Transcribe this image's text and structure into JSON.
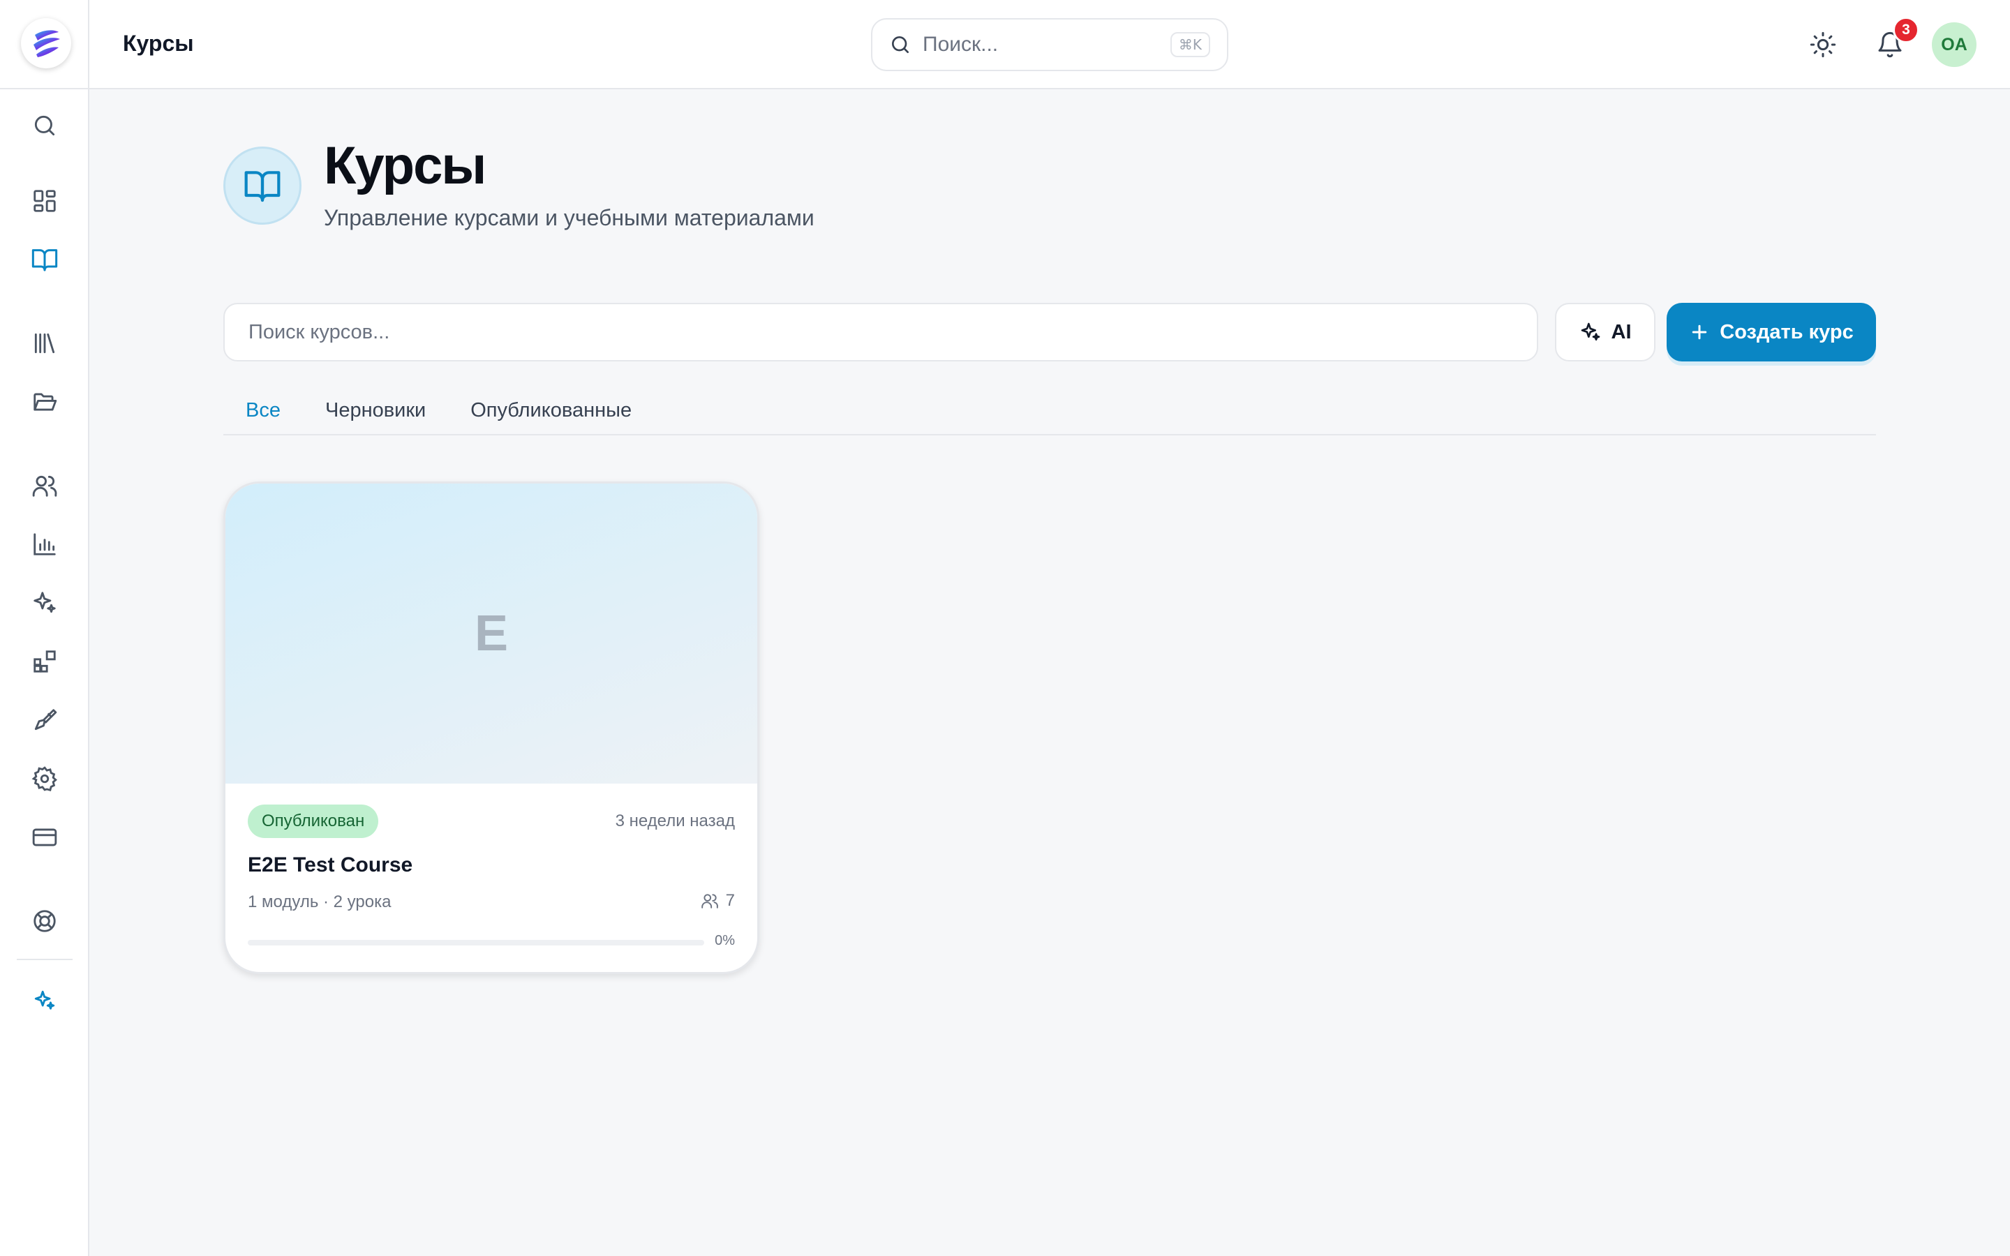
{
  "header": {
    "title": "Курсы",
    "search_placeholder": "Поиск...",
    "search_shortcut": "⌘K",
    "notifications_count": "3",
    "avatar_initials": "OA"
  },
  "sidebar": {
    "items": [
      {
        "name": "search",
        "icon": "search-icon"
      },
      {
        "name": "dashboard",
        "icon": "dashboard-icon"
      },
      {
        "name": "courses",
        "icon": "book-open-icon",
        "active": true
      },
      {
        "name": "library",
        "icon": "library-icon"
      },
      {
        "name": "files",
        "icon": "folder-open-icon"
      },
      {
        "name": "users",
        "icon": "users-icon"
      },
      {
        "name": "analytics",
        "icon": "bar-chart-icon"
      },
      {
        "name": "ai",
        "icon": "sparkles-icon"
      },
      {
        "name": "integrations",
        "icon": "blocks-icon"
      },
      {
        "name": "branding",
        "icon": "paintbrush-icon"
      },
      {
        "name": "settings",
        "icon": "gear-icon"
      },
      {
        "name": "billing",
        "icon": "credit-card-icon"
      },
      {
        "name": "support",
        "icon": "lifebuoy-icon"
      },
      {
        "name": "ai-assistant",
        "icon": "sparkles-icon"
      }
    ]
  },
  "page": {
    "title": "Курсы",
    "subtitle": "Управление курсами и учебными материалами",
    "search_placeholder": "Поиск курсов...",
    "ai_label": "AI",
    "create_label": "Создать курс"
  },
  "tabs": [
    {
      "label": "Все",
      "active": true
    },
    {
      "label": "Черновики",
      "active": false
    },
    {
      "label": "Опубликованные",
      "active": false
    }
  ],
  "courses": [
    {
      "cover_letter": "E",
      "status": "Опубликован",
      "updated": "3 недели назад",
      "title": "E2E Test Course",
      "meta": "1 модуль · 2 урока",
      "students": "7",
      "progress_label": "0%",
      "progress": 0
    }
  ],
  "colors": {
    "accent": "#0a86c4",
    "badge_red": "#e5262f",
    "status_green_bg": "#bff0cf",
    "status_green_text": "#166534"
  }
}
